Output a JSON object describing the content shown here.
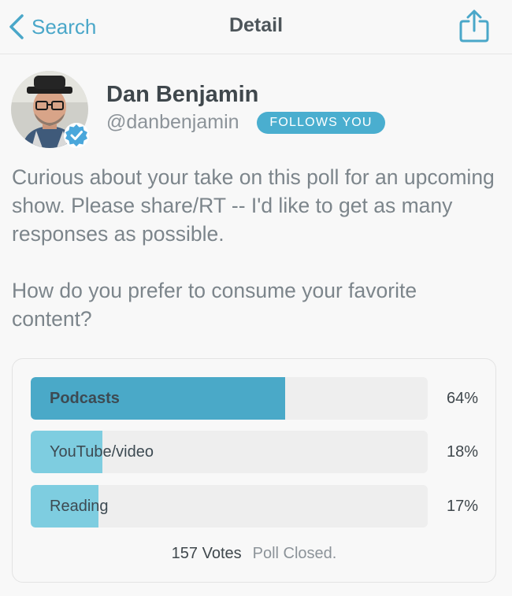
{
  "nav": {
    "back_label": "Search",
    "title": "Detail"
  },
  "author": {
    "name": "Dan Benjamin",
    "handle": "@danbenjamin",
    "badge": "FOLLOWS YOU",
    "verified": true
  },
  "tweet": {
    "paragraphs": [
      "Curious about your take on this poll for an upcoming show. Please share/RT -- I'd like to get as many responses as possible.",
      "How do you prefer to consume your favorite content?"
    ]
  },
  "poll": {
    "options": [
      {
        "label": "Podcasts",
        "percent": "64%",
        "fraction": 0.64,
        "winner": true
      },
      {
        "label": "YouTube/video",
        "percent": "18%",
        "fraction": 0.18,
        "winner": false
      },
      {
        "label": "Reading",
        "percent": "17%",
        "fraction": 0.17,
        "winner": false
      }
    ],
    "votes": "157 Votes",
    "status": "Poll Closed."
  },
  "colors": {
    "accent": "#4aa7c9",
    "poll_winner_fill": "#4aa9c8",
    "poll_other_fill": "#7ecde0",
    "poll_track": "#eeeeee"
  }
}
